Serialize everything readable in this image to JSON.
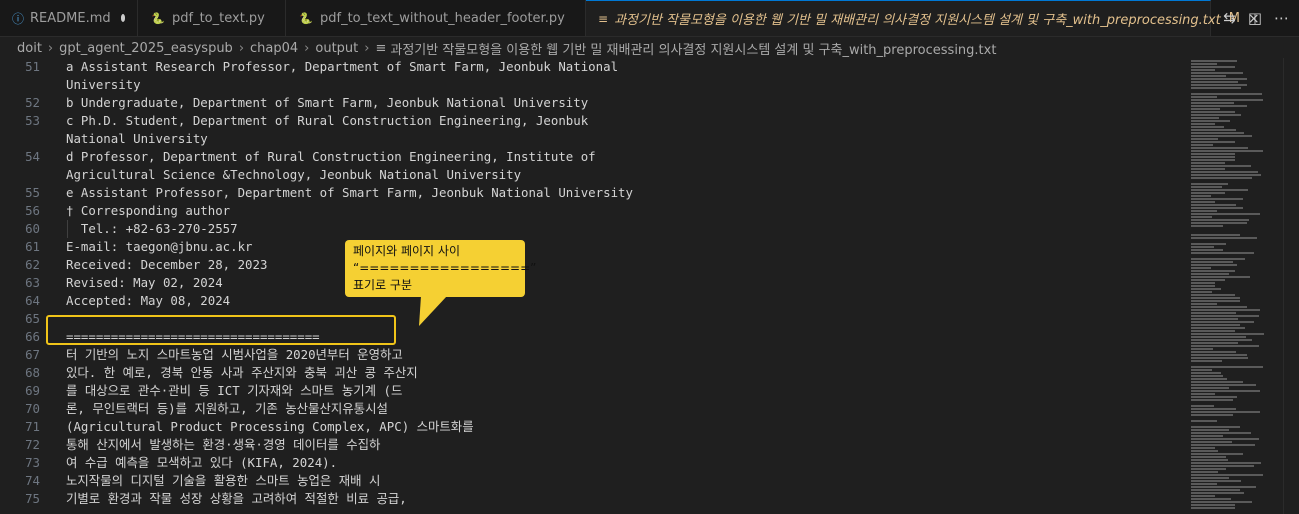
{
  "tabs": [
    {
      "label": "README.md",
      "icon": "info-icon",
      "icon_glyph": "ⓘ",
      "state": "dot"
    },
    {
      "label": "pdf_to_text.py",
      "icon": "python-icon",
      "icon_glyph": "🐍"
    },
    {
      "label": "pdf_to_text_without_header_footer.py",
      "icon": "python-icon",
      "icon_glyph": "🐍"
    },
    {
      "label": "과정기반 작물모형을 이용한 웹 기반 밀 재배관리 의사결정 지원시스템 설계 및 구축_with_preprocessing.txt",
      "icon": "text-file-icon",
      "icon_glyph": "≡",
      "modified": "M",
      "close": "×",
      "active": true
    }
  ],
  "breadcrumb": [
    "doit",
    "gpt_agent_2025_easyspub",
    "chap04",
    "output",
    "과정기반 작물모형을 이용한 웹 기반 밀 재배관리 의사결정 지원시스템 설계 및 구축_with_preprocessing.txt"
  ],
  "breadcrumb_sep": "›",
  "lines": [
    {
      "n": "51",
      "t": "a Assistant Research Professor, Department of Smart Farm, Jeonbuk National"
    },
    {
      "n": "",
      "t": "University"
    },
    {
      "n": "52",
      "t": "b Undergraduate, Department of Smart Farm, Jeonbuk National University"
    },
    {
      "n": "53",
      "t": "c Ph.D. Student, Department of Rural Construction Engineering, Jeonbuk"
    },
    {
      "n": "",
      "t": "National University"
    },
    {
      "n": "54",
      "t": "d Professor, Department of Rural Construction Engineering, Institute of"
    },
    {
      "n": "",
      "t": "Agricultural Science &Technology, Jeonbuk National University"
    },
    {
      "n": "55",
      "t": "e Assistant Professor, Department of Smart Farm, Jeonbuk National University"
    },
    {
      "n": "56",
      "t": "† Corresponding author"
    },
    {
      "n": "60",
      "t": "  Tel.: +82-63-270-2557"
    },
    {
      "n": "61",
      "t": "E-mail: taegon@jbnu.ac.kr"
    },
    {
      "n": "62",
      "t": "Received: December 28, 2023"
    },
    {
      "n": "63",
      "t": "Revised: May 02, 2024"
    },
    {
      "n": "64",
      "t": "Accepted: May 08, 2024"
    },
    {
      "n": "65",
      "t": ""
    },
    {
      "n": "66",
      "t": "=================================="
    },
    {
      "n": "67",
      "t": "터 기반의 노지 스마트농업 시범사업을 2020년부터 운영하고"
    },
    {
      "n": "68",
      "t": "있다. 한 예로, 경북 안동 사과 주산지와 충북 괴산 콩 주산지"
    },
    {
      "n": "69",
      "t": "를 대상으로 관수·관비 등 ICT 기자재와 스마트 농기계 (드"
    },
    {
      "n": "70",
      "t": "론, 무인트랙터 등)를 지원하고, 기존 농산물산지유통시설"
    },
    {
      "n": "71",
      "t": "(Agricultural Product Processing Complex, APC) 스마트화를"
    },
    {
      "n": "72",
      "t": "통해 산지에서 발생하는 환경·생육·경영 데이터를 수집하"
    },
    {
      "n": "73",
      "t": "여 수급 예측을 모색하고 있다 (KIFA, 2024)."
    },
    {
      "n": "74",
      "t": "노지작물의 디지털 기술을 활용한 스마트 농업은 재배 시"
    },
    {
      "n": "75",
      "t": "기별로 환경과 작물 성장 상황을 고려하여 적절한 비료 공급,"
    }
  ],
  "callout": {
    "line1": "페이지와 페이지 사이",
    "line2": "“=================”",
    "line3": "표기로 구분"
  },
  "toolbar_icons": [
    {
      "name": "compare-changes-icon",
      "glyph": "⇆"
    },
    {
      "name": "split-editor-icon",
      "glyph": "◫"
    },
    {
      "name": "more-actions-icon",
      "glyph": "⋯"
    }
  ],
  "colors": {
    "highlight": "#f0c419",
    "callout_bg": "#f5d033",
    "modified": "#e2c08d",
    "active_border": "#0078d4"
  }
}
